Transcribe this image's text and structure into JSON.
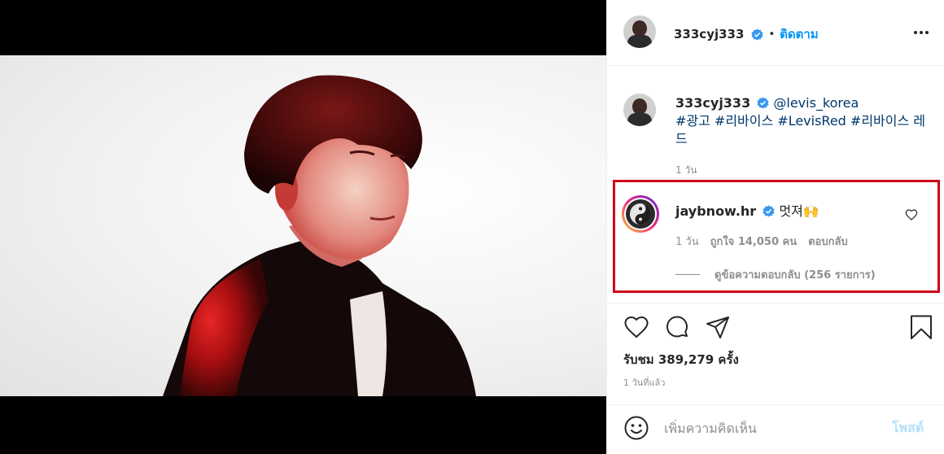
{
  "post": {
    "author": "333cyj333",
    "follow_separator": "•",
    "follow_label": "ติดตาม"
  },
  "caption": {
    "author": "333cyj333",
    "mention": "@levis_korea",
    "hashtags": "#광고 #리바이스 #LevisRed #리바이스 레드",
    "time": "1 วัน"
  },
  "comment": {
    "author": "jaybnow.hr",
    "text": "멋져🙌",
    "time": "1 วัน",
    "likes": "ถูกใจ 14,050 คน",
    "reply_label": "ตอบกลับ",
    "view_replies": "ดูข้อความตอบกลับ (256 รายการ)"
  },
  "stats": {
    "views": "รับชม 389,279 ครั้ง",
    "posted_ago": "1 วันที่แล้ว"
  },
  "composer": {
    "placeholder": "เพิ่มความคิดเห็น",
    "post_label": "โพสต์"
  },
  "icons": {
    "mute": "muted-speaker-icon",
    "verified": "verified-badge-icon",
    "more": "more-options-icon",
    "like": "heart-icon",
    "comment": "comment-bubble-icon",
    "share": "paper-plane-icon",
    "save": "bookmark-icon",
    "emoji": "smiley-icon"
  },
  "colors": {
    "accent": "#0095f6",
    "highlight_box": "#d0021b",
    "muted_text": "#8e8e8e"
  }
}
